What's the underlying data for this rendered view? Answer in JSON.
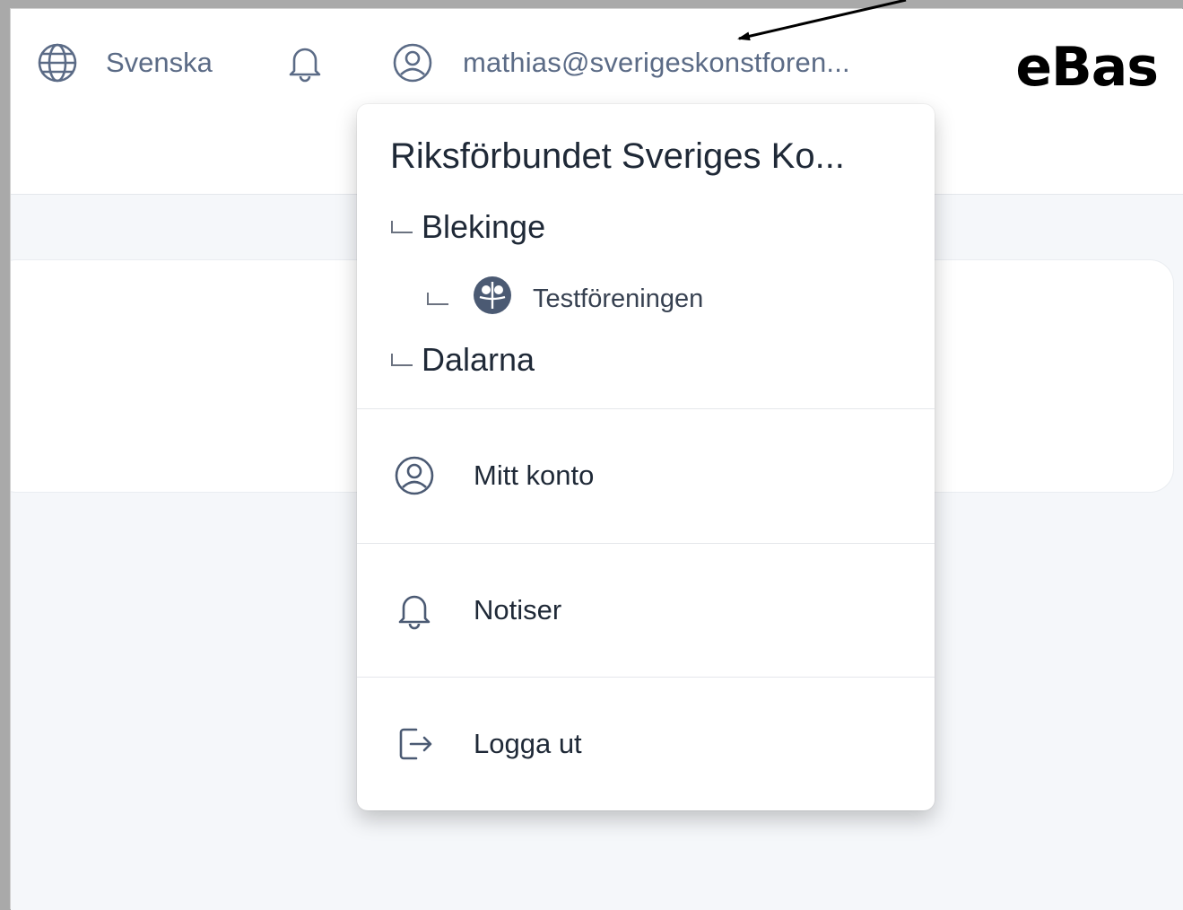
{
  "header": {
    "language_label": "Svenska",
    "user_email": "mathias@sverigeskonstforen...",
    "logo_text": "eBas"
  },
  "dropdown": {
    "org_title": "Riksförbundet Sveriges Ko...",
    "tree": [
      {
        "label": "Blekinge"
      },
      {
        "label": "Testföreningen"
      },
      {
        "label": "Dalarna"
      }
    ],
    "menu": [
      {
        "label": "Mitt konto",
        "icon": "user-circle-icon"
      },
      {
        "label": "Notiser",
        "icon": "bell-icon"
      },
      {
        "label": "Logga ut",
        "icon": "logout-icon"
      }
    ]
  },
  "colors": {
    "header_text": "#5b6b86",
    "background": "#f5f7fa",
    "menu_text": "#1f2937"
  }
}
